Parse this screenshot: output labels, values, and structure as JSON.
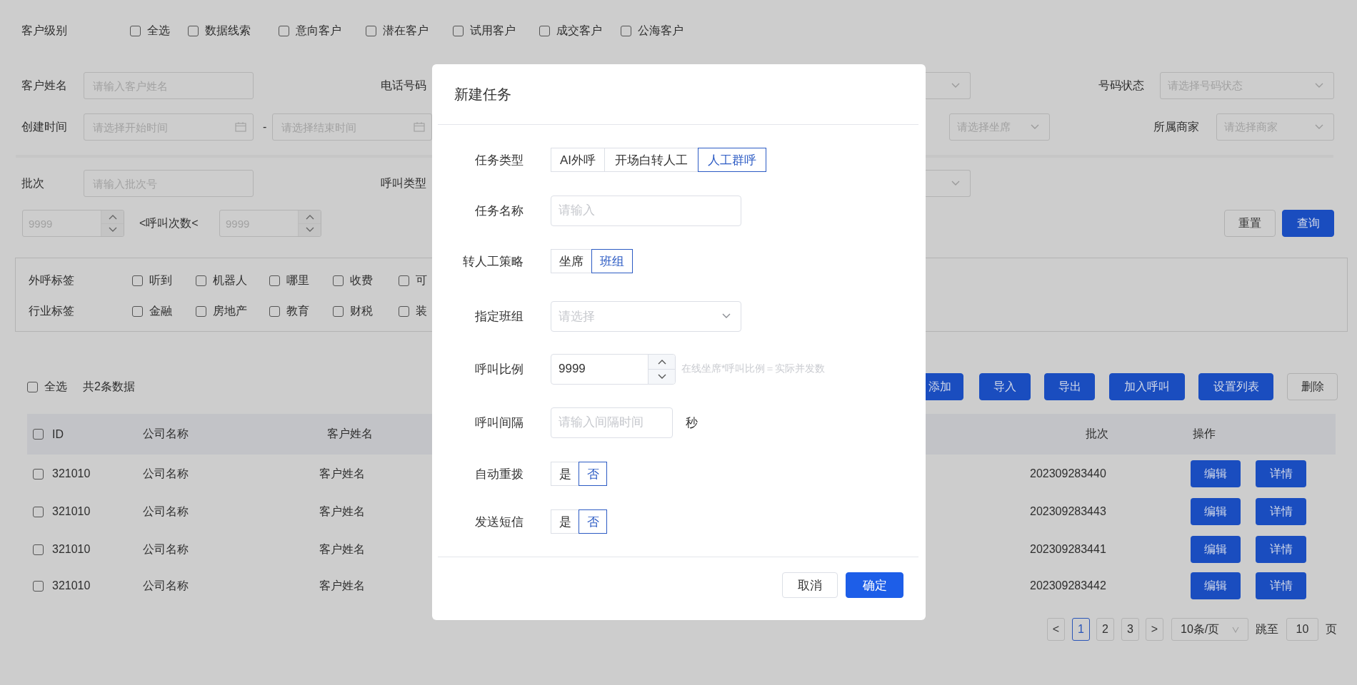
{
  "filters": {
    "level": {
      "label": "客户级别",
      "options": [
        {
          "label": "全选",
          "checked": false
        },
        {
          "label": "数据线索",
          "checked": false
        },
        {
          "label": "意向客户",
          "checked": false
        },
        {
          "label": "潜在客户",
          "checked": false
        },
        {
          "label": "试用客户",
          "checked": false
        },
        {
          "label": "成交客户",
          "checked": false
        },
        {
          "label": "公海客户",
          "checked": false
        }
      ]
    },
    "fields": [
      {
        "label": "客户姓名",
        "kind": "input",
        "placeholder": "请输入客户姓名"
      },
      {
        "label": "电话号码",
        "kind": "select"
      },
      {
        "label": "号码状态",
        "kind": "select",
        "placeholder": "请选择号码状态"
      },
      {
        "label": "创建时间",
        "kind": "date_range",
        "start_placeholder": "请选择开始时间",
        "separator": "-",
        "end_placeholder": "请选择结束时间"
      },
      {
        "kind": "select",
        "placeholder": "请选择坐席"
      },
      {
        "label": "所属商家",
        "kind": "select",
        "placeholder": "请选择商家"
      },
      {
        "label": "批次",
        "kind": "input",
        "placeholder": "请输入批次号"
      },
      {
        "label": "呼叫类型",
        "kind": "select"
      }
    ],
    "call_count": {
      "min_placeholder": "9999",
      "label": "<呼叫次数<",
      "max_placeholder": "9999"
    },
    "buttons": [
      {
        "label": "重置",
        "primary": false
      },
      {
        "label": "查询",
        "primary": true
      }
    ]
  },
  "tags": [
    {
      "label": "外呼标签",
      "options": [
        {
          "label": "听到",
          "checked": false
        },
        {
          "label": "机器人",
          "checked": false
        },
        {
          "label": "哪里",
          "checked": false
        },
        {
          "label": "收费",
          "checked": false
        },
        {
          "label": "可",
          "checked": false
        }
      ]
    },
    {
      "label": "行业标签",
      "options": [
        {
          "label": "金融",
          "checked": false
        },
        {
          "label": "房地产",
          "checked": false
        },
        {
          "label": "教育",
          "checked": false
        },
        {
          "label": "财税",
          "checked": false
        },
        {
          "label": "装",
          "checked": false
        }
      ]
    }
  ],
  "toolbar": {
    "select_all": {
      "label": "全选",
      "checked": false
    },
    "count": "共2条数据",
    "actions": [
      {
        "label": "添加",
        "primary": true
      },
      {
        "label": "导入",
        "primary": true
      },
      {
        "label": "导出",
        "primary": true
      },
      {
        "label": "加入呼叫",
        "primary": true
      },
      {
        "label": "设置列表",
        "primary": true
      },
      {
        "label": "删除",
        "primary": false
      }
    ]
  },
  "table": {
    "header_checked": false,
    "columns": [
      {
        "label": "ID"
      },
      {
        "label": "公司名称"
      },
      {
        "label": "客户姓名"
      },
      {
        "label": "批次"
      },
      {
        "label": "操作"
      }
    ],
    "rows": [
      {
        "checked": false,
        "id": "321010",
        "company": "公司名称",
        "customer": "客户姓名",
        "batch": "202309283440",
        "actions": [
          "编辑",
          "详情"
        ]
      },
      {
        "checked": false,
        "id": "321010",
        "company": "公司名称",
        "customer": "客户姓名",
        "batch": "202309283443",
        "actions": [
          "编辑",
          "详情"
        ]
      },
      {
        "checked": false,
        "id": "321010",
        "company": "公司名称",
        "customer": "客户姓名",
        "batch": "202309283441",
        "actions": [
          "编辑",
          "详情"
        ]
      },
      {
        "checked": false,
        "id": "321010",
        "company": "公司名称",
        "customer": "客户姓名",
        "batch": "202309283442",
        "actions": [
          "编辑",
          "详情"
        ]
      }
    ]
  },
  "pagination": {
    "prev": "<",
    "pages": [
      {
        "label": "1",
        "selected": true
      },
      {
        "label": "2",
        "selected": false
      },
      {
        "label": "3",
        "selected": false
      }
    ],
    "next": ">",
    "page_size": "10条/页",
    "jump_label": "跳至",
    "jump_value": "10",
    "jump_suffix": "页"
  },
  "dialog": {
    "title": "新建任务",
    "fields": [
      {
        "kind": "segmented",
        "label": "任务类型",
        "options": [
          {
            "label": "AI外呼",
            "selected": false
          },
          {
            "label": "开场白转人工",
            "selected": false
          },
          {
            "label": "人工群呼",
            "selected": true
          }
        ]
      },
      {
        "kind": "input",
        "label": "任务名称",
        "placeholder": "请输入"
      },
      {
        "kind": "segmented",
        "label": "转人工策略",
        "options": [
          {
            "label": "坐席",
            "selected": false
          },
          {
            "label": "班组",
            "selected": true
          }
        ]
      },
      {
        "kind": "select",
        "label": "指定班组",
        "placeholder": "请选择"
      },
      {
        "kind": "number",
        "label": "呼叫比例",
        "value": "9999",
        "hint": "在线坐席*呼叫比例＝实际并发数"
      },
      {
        "kind": "input",
        "label": "呼叫间隔",
        "placeholder": "请输入间隔时间",
        "suffix": "秒"
      },
      {
        "kind": "segmented",
        "label": "自动重拨",
        "options": [
          {
            "label": "是",
            "selected": false
          },
          {
            "label": "否",
            "selected": true
          }
        ]
      },
      {
        "kind": "segmented",
        "label": "发送短信",
        "options": [
          {
            "label": "是",
            "selected": false
          },
          {
            "label": "否",
            "selected": true
          }
        ]
      }
    ],
    "buttons": [
      {
        "label": "取消",
        "primary": false
      },
      {
        "label": "确定",
        "primary": true
      }
    ]
  }
}
